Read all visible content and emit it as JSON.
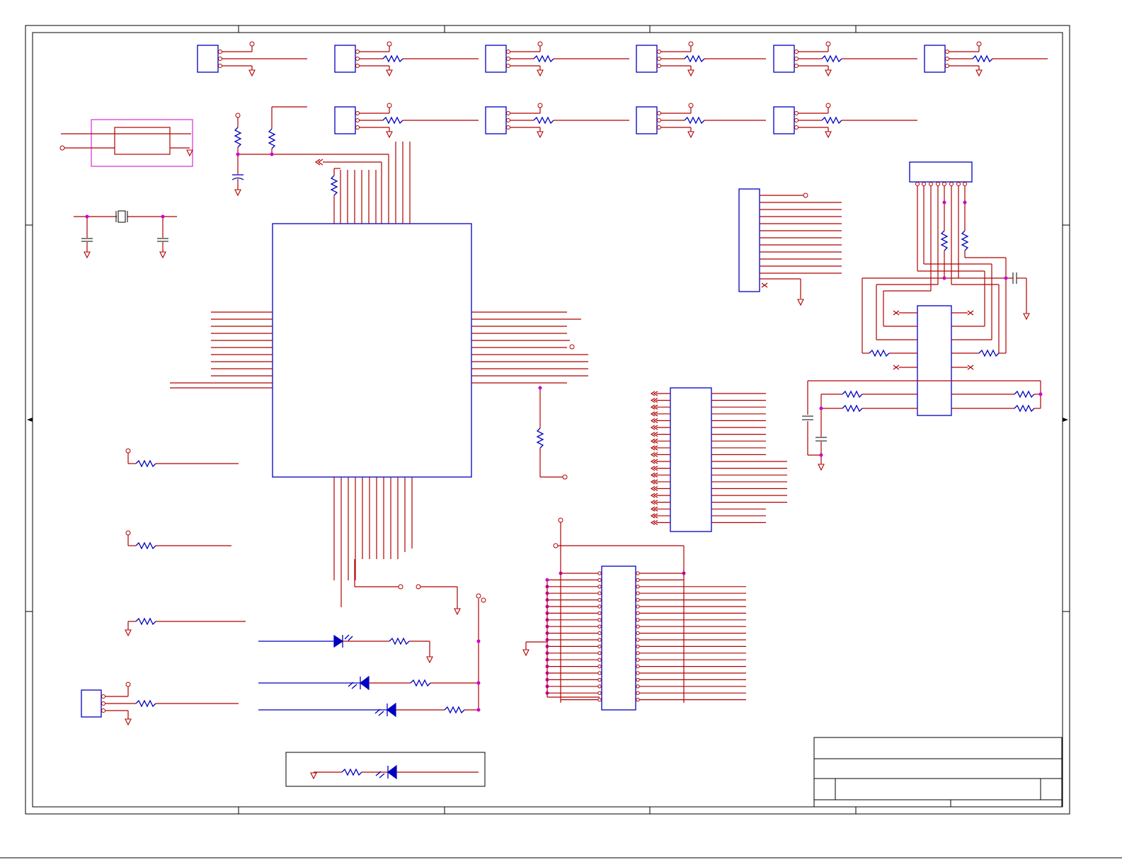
{
  "sheet": {
    "title_block_fields": [
      "",
      "",
      "",
      "",
      "",
      ""
    ]
  },
  "colors": {
    "wire": "#b00000",
    "component": "#0000c0",
    "frame": "#000000",
    "junction": "#cc00cc"
  },
  "icons": [
    "resistor-icon",
    "capacitor-icon",
    "ground-icon",
    "crystal-icon",
    "led-icon",
    "connector-icon",
    "ic-icon"
  ]
}
